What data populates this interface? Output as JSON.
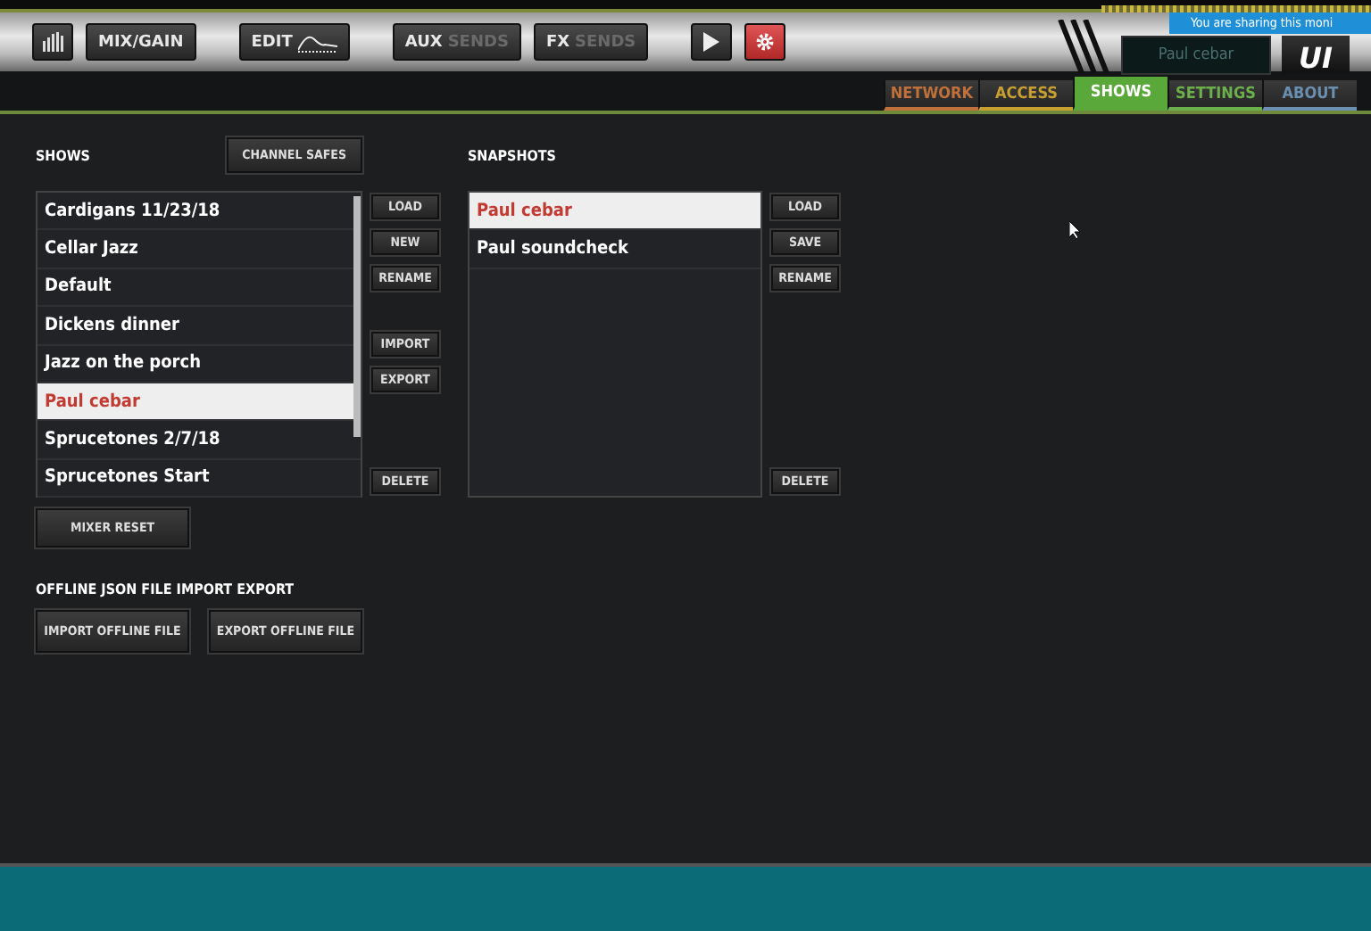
{
  "toolbar": {
    "buttons": [
      {
        "kind": "meter"
      },
      {
        "kind": "text",
        "label": "MIX/GAIN"
      },
      {
        "kind": "edit",
        "label": "EDIT"
      },
      {
        "kind": "split",
        "label": "AUX",
        "sub": "SENDS"
      },
      {
        "kind": "split",
        "label": "FX",
        "sub": "SENDS"
      },
      {
        "kind": "play"
      },
      {
        "kind": "gear",
        "active": true
      }
    ],
    "display": "Paul cebar",
    "logo": "UI",
    "sharing_banner": "You are sharing this moni"
  },
  "tabs": [
    {
      "label": "NETWORK",
      "selected": false,
      "color": "#c0703a"
    },
    {
      "label": "ACCESS",
      "selected": false,
      "color": "#c8a030"
    },
    {
      "label": "SHOWS",
      "selected": true,
      "color": "#5aa83a"
    },
    {
      "label": "SETTINGS",
      "selected": false,
      "color": "#6cb04c"
    },
    {
      "label": "ABOUT",
      "selected": false,
      "color": "#6a8fb0"
    }
  ],
  "shows": {
    "title": "SHOWS",
    "header_button": "CHANNEL SAFES",
    "items": [
      {
        "label": "Cardigans 11/23/18",
        "selected": false
      },
      {
        "label": "Cellar Jazz",
        "selected": false
      },
      {
        "label": "Default",
        "selected": false
      },
      {
        "label": "Dickens dinner",
        "selected": false
      },
      {
        "label": "Jazz on the porch",
        "selected": false
      },
      {
        "label": "Paul cebar",
        "selected": true
      },
      {
        "label": "Sprucetones 2/7/18",
        "selected": false
      },
      {
        "label": "Sprucetones Start",
        "selected": false
      }
    ],
    "action_groups": [
      [
        "LOAD",
        "NEW",
        "RENAME"
      ],
      [
        "IMPORT",
        "EXPORT"
      ],
      [
        "DELETE"
      ]
    ],
    "footer_button": "MIXER RESET"
  },
  "snapshots": {
    "title": "SNAPSHOTS",
    "items": [
      {
        "label": "Paul cebar",
        "selected": true
      },
      {
        "label": "Paul soundcheck",
        "selected": false
      }
    ],
    "action_groups": [
      [
        "LOAD",
        "SAVE",
        "RENAME"
      ],
      [
        "DELETE"
      ]
    ]
  },
  "offline": {
    "title": "OFFLINE JSON FILE IMPORT EXPORT",
    "buttons": [
      "IMPORT OFFLINE FILE",
      "EXPORT OFFLINE FILE"
    ]
  }
}
